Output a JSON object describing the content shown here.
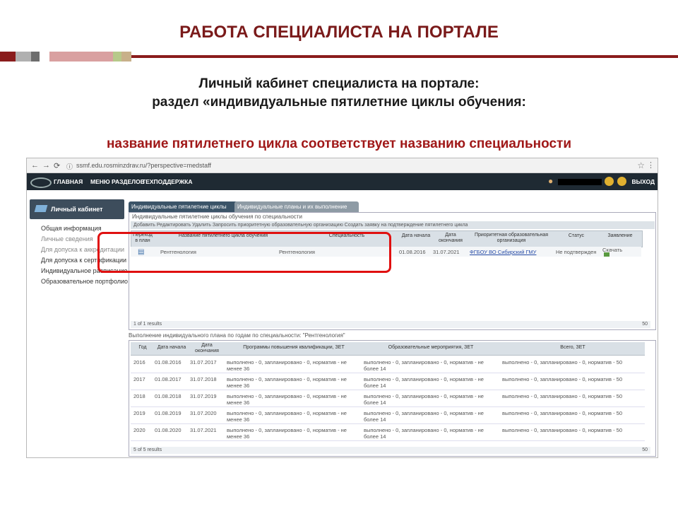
{
  "slide": {
    "title": "РАБОТА СПЕЦИАЛИСТА НА ПОРТАЛЕ",
    "subtitle_line1": "Личный кабинет специалиста на портале:",
    "subtitle_line2": "раздел «индивидуальные пятилетние циклы обучения:",
    "note": "название пятилетнего цикла соответствует названию специальности"
  },
  "browser": {
    "url": "ssmf.edu.rosminzdrav.ru/?perspective=medstaff"
  },
  "topnav": {
    "items": [
      "ГЛАВНАЯ",
      "МЕНЮ РАЗДЕЛОВ",
      "ТЕХПОДДЕРЖКА"
    ],
    "exit": "ВЫХОД"
  },
  "sidebar": {
    "header": "Личный кабинет",
    "items": [
      "Общая информация",
      "Личные сведения",
      "Для допуска к аккредитации",
      "Для допуска к сертификации",
      "Индивидуальное расписание",
      "Образовательное портфолио"
    ]
  },
  "tabs": [
    "Индивидуальные пятилетние циклы",
    "Индивидуальные планы и их выполнение"
  ],
  "cycles": {
    "title": "Индивидуальные пятилетние циклы обучения по специальности",
    "toolbar": "Добавить   Редактировать   Удалить   Запросить приоритетную образовательную организацию   Создать заявку на подтверждение пятилетнего цикла",
    "headers": [
      "Переход в план",
      "Название пятилетнего цикла обучения",
      "Специальность",
      "Дата начала",
      "Дата окончания",
      "Приоритетная образовательная организация",
      "Статус",
      "Заявление"
    ],
    "row": {
      "name": "Рентгенология",
      "specialty": "Рентгенология",
      "start": "01.08.2016",
      "end": "31.07.2021",
      "org": "ФГБОУ ВО Сибирский ГМУ",
      "status": "Не подтвержден",
      "action": "Скачать"
    },
    "results": "1 of 1 results",
    "page_size": "50"
  },
  "plan": {
    "title": "Выполнение индивидуального плана по годам по специальности: \"Рентгенология\"",
    "headers": [
      "Год",
      "Дата начала",
      "Дата окончания",
      "Программы повышения квалификации, ЗЕТ",
      "Образовательные мероприятия, ЗЕТ",
      "Всего, ЗЕТ"
    ],
    "rows": [
      {
        "year": "2016",
        "start": "01.08.2016",
        "end": "31.07.2017",
        "programs": "выполнено - 0, запланировано - 0, норматив - не менее 36",
        "events": "выполнено - 0, запланировано - 0, норматив - не более 14",
        "total": "выполнено - 0, запланировано - 0, норматив - 50"
      },
      {
        "year": "2017",
        "start": "01.08.2017",
        "end": "31.07.2018",
        "programs": "выполнено - 0, запланировано - 0, норматив - не менее 36",
        "events": "выполнено - 0, запланировано - 0, норматив - не более 14",
        "total": "выполнено - 0, запланировано - 0, норматив - 50"
      },
      {
        "year": "2018",
        "start": "01.08.2018",
        "end": "31.07.2019",
        "programs": "выполнено - 0, запланировано - 0, норматив - не менее 36",
        "events": "выполнено - 0, запланировано - 0, норматив - не более 14",
        "total": "выполнено - 0, запланировано - 0, норматив - 50"
      },
      {
        "year": "2019",
        "start": "01.08.2019",
        "end": "31.07.2020",
        "programs": "выполнено - 0, запланировано - 0, норматив - не менее 36",
        "events": "выполнено - 0, запланировано - 0, норматив - не более 14",
        "total": "выполнено - 0, запланировано - 0, норматив - 50"
      },
      {
        "year": "2020",
        "start": "01.08.2020",
        "end": "31.07.2021",
        "programs": "выполнено - 0, запланировано - 0, норматив - не менее 36",
        "events": "выполнено - 0, запланировано - 0, норматив - не более 14",
        "total": "выполнено - 0, запланировано - 0, норматив - 50"
      }
    ],
    "results": "5 of 5 results",
    "page_size": "50"
  }
}
